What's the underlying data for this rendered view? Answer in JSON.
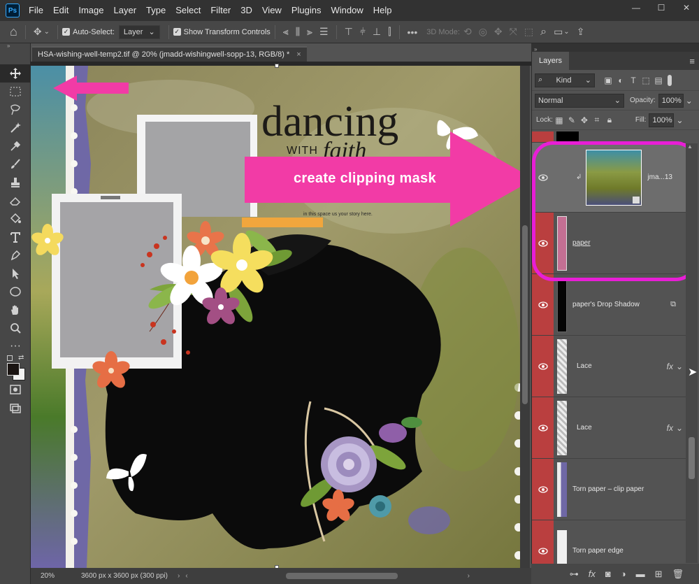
{
  "app": {
    "logo": "Ps"
  },
  "menu": [
    "File",
    "Edit",
    "Image",
    "Layer",
    "Type",
    "Select",
    "Filter",
    "3D",
    "View",
    "Plugins",
    "Window",
    "Help"
  ],
  "window_controls": {
    "min": "—",
    "max": "☐",
    "close": "✕"
  },
  "options_bar": {
    "auto_select_label": "Auto-Select:",
    "auto_select_value": "Layer",
    "show_transform_label": "Show Transform Controls",
    "more": "•••",
    "mode_label": "3D Mode:"
  },
  "document": {
    "tab_title": "HSA-wishing-well-temp2.tif @ 20% (jmadd-wishingwell-sopp-13, RGB/8) *",
    "close": "×",
    "zoom": "20%",
    "doc_info": "3600 px x 3600 px (300 ppi)"
  },
  "canvas_art": {
    "title_word": "dancing",
    "subtitle_word": "WITH",
    "script_word": "faith",
    "body_text": "in this space  us your story here."
  },
  "callout": {
    "text": "create clipping mask",
    "arrow_color": "#f23ba6",
    "highlight_color": "#e81ed6"
  },
  "layers_panel": {
    "tab": "Layers",
    "filter_kind": "Kind",
    "blend_mode": "Normal",
    "opacity_label": "Opacity:",
    "opacity_value": "100%",
    "lock_label": "Lock:",
    "fill_label": "Fill:",
    "fill_value": "100%",
    "layers": [
      {
        "name": "jma...13",
        "thumb": "gradient",
        "clipped": true,
        "selected": true
      },
      {
        "name": "paper",
        "thumb": "pink"
      },
      {
        "name": "paper's Drop Shadow",
        "thumb": "black",
        "smart": true
      },
      {
        "name": "Lace",
        "thumb": "lace",
        "fx": "fx"
      },
      {
        "name": "Lace",
        "thumb": "lace",
        "fx": "fx"
      },
      {
        "name": "Torn paper – clip paper",
        "thumb": "torn"
      },
      {
        "name": "Torn paper edge",
        "thumb": "edge"
      }
    ]
  },
  "colors": {
    "menubar": "#323232",
    "panel": "#535353",
    "eye_cell": "#ba3f3f",
    "selected_layer": "#6d6d6d"
  }
}
